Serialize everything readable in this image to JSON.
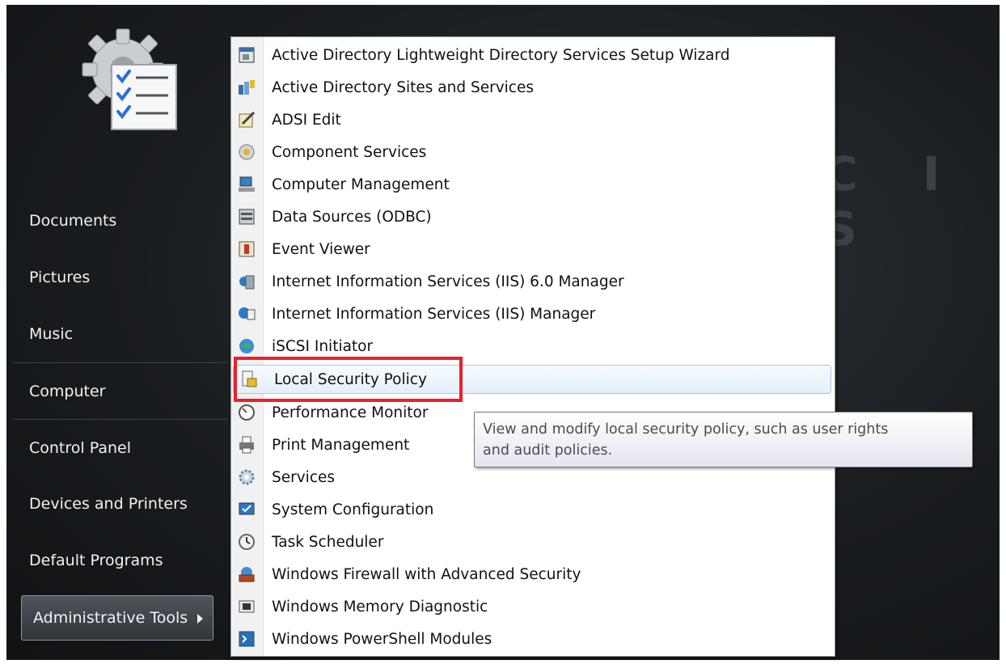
{
  "background_text": "C I S",
  "left_menu": {
    "items": [
      {
        "label": "Documents"
      },
      {
        "label": "Pictures"
      },
      {
        "label": "Music"
      },
      {
        "label": "Computer"
      },
      {
        "label": "Control Panel"
      },
      {
        "label": "Devices and Printers"
      },
      {
        "label": "Default Programs"
      },
      {
        "label": "Administrative Tools",
        "active": true
      }
    ]
  },
  "submenu": {
    "items": [
      {
        "label": "Active Directory Lightweight Directory Services Setup Wizard",
        "icon": "setup-wizard-icon"
      },
      {
        "label": "Active Directory Sites and Services",
        "icon": "sites-services-icon"
      },
      {
        "label": "ADSI Edit",
        "icon": "adsi-edit-icon"
      },
      {
        "label": "Component Services",
        "icon": "component-services-icon"
      },
      {
        "label": "Computer Management",
        "icon": "computer-management-icon"
      },
      {
        "label": "Data Sources (ODBC)",
        "icon": "odbc-icon"
      },
      {
        "label": "Event Viewer",
        "icon": "event-viewer-icon"
      },
      {
        "label": "Internet Information Services (IIS) 6.0 Manager",
        "icon": "iis6-icon"
      },
      {
        "label": "Internet Information Services (IIS) Manager",
        "icon": "iis-icon"
      },
      {
        "label": "iSCSI Initiator",
        "icon": "iscsi-icon"
      },
      {
        "label": "Local Security Policy",
        "icon": "security-policy-icon",
        "hover": true
      },
      {
        "label": "Performance Monitor",
        "icon": "performance-monitor-icon"
      },
      {
        "label": "Print Management",
        "icon": "printer-icon"
      },
      {
        "label": "Services",
        "icon": "services-gear-icon"
      },
      {
        "label": "System Configuration",
        "icon": "system-config-icon"
      },
      {
        "label": "Task Scheduler",
        "icon": "clock-icon"
      },
      {
        "label": "Windows Firewall with Advanced Security",
        "icon": "firewall-icon"
      },
      {
        "label": "Windows Memory Diagnostic",
        "icon": "memory-icon"
      },
      {
        "label": "Windows PowerShell Modules",
        "icon": "powershell-icon"
      }
    ]
  },
  "tooltip": {
    "line1": "View and modify local security policy, such as user rights",
    "line2": "and audit policies."
  },
  "colors": {
    "highlight_box": "#e8212b",
    "hover_border": "#a7c6e8"
  }
}
